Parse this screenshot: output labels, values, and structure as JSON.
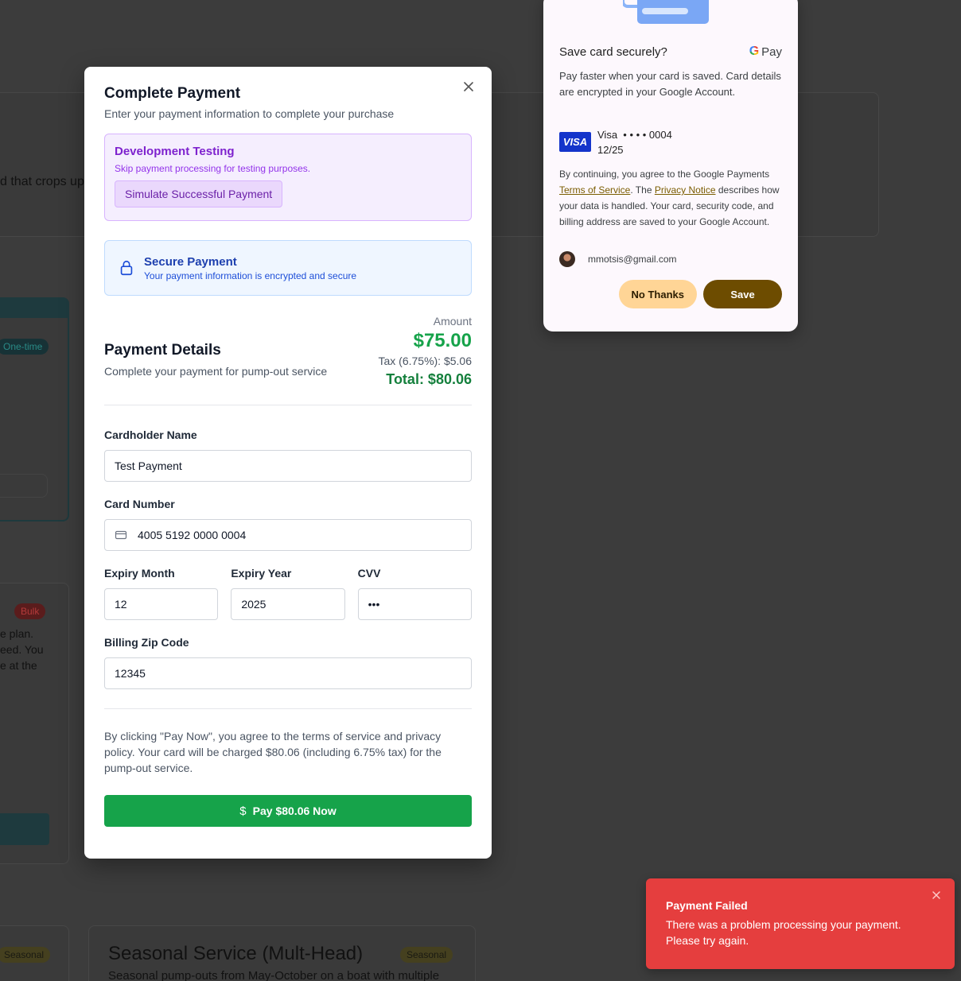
{
  "background": {
    "fragment_text_1": "d that crops up",
    "badge_onetime": "One-time",
    "badge_bulk": "Bulk",
    "fragment_lines": [
      "e plan.",
      "eed. You",
      "e at the"
    ],
    "badge_seasonal_left": "Seasonal",
    "seasonal_card_title": "Seasonal Service (Mult-Head)",
    "badge_seasonal_right": "Seasonal",
    "seasonal_card_desc": "Seasonal pump-outs from May-October on a boat with multiple"
  },
  "modal": {
    "title": "Complete Payment",
    "subtitle": "Enter your payment information to complete your purchase",
    "close_icon": "close-icon",
    "dev_testing": {
      "title": "Development Testing",
      "subtitle": "Skip payment processing for testing purposes.",
      "button_label": "Simulate Successful Payment"
    },
    "secure": {
      "icon": "lock-icon",
      "title": "Secure Payment",
      "subtitle": "Your payment information is encrypted and secure"
    },
    "details": {
      "title": "Payment Details",
      "subtitle": "Complete your payment for pump-out service",
      "amount_label": "Amount",
      "amount_value": "$75.00",
      "tax_line": "Tax (6.75%): $5.06",
      "total_line": "Total: $80.06"
    },
    "form": {
      "cardholder_label": "Cardholder Name",
      "cardholder_value": "Test Payment",
      "card_number_label": "Card Number",
      "card_number_value": "4005 5192 0000 0004",
      "expiry_month_label": "Expiry Month",
      "expiry_month_value": "12",
      "expiry_year_label": "Expiry Year",
      "expiry_year_value": "2025",
      "cvv_label": "CVV",
      "cvv_value": "•••",
      "zip_label": "Billing Zip Code",
      "zip_value": "12345"
    },
    "terms": "By clicking \"Pay Now\", you agree to the terms of service and privacy policy. Your card will be charged $80.06 (including 6.75% tax) for the pump-out service.",
    "pay_button": {
      "icon": "$",
      "label": "Pay $80.06 Now"
    }
  },
  "gpay": {
    "title": "Save card securely?",
    "logo_text": "Pay",
    "description": "Pay faster when your card is saved. Card details are encrypted in your Google Account.",
    "card_brand": "VISA",
    "card_line": "Visa  • • • • 0004",
    "card_expiry": "12/25",
    "legal_prefix": "By continuing, you agree to the Google Payments ",
    "legal_tos": "Terms of Service",
    "legal_mid": ". The ",
    "legal_privacy": "Privacy Notice",
    "legal_suffix": " describes how your data is handled. Your card, security code, and billing address are saved to your Google Account.",
    "email": "mmotsis@gmail.com",
    "no_thanks": "No Thanks",
    "save": "Save"
  },
  "toast": {
    "title": "Payment Failed",
    "message": "There was a problem processing your payment. Please try again."
  },
  "colors": {
    "overlay": "#3c3c3c",
    "pay_green": "#16a34a",
    "toast_red": "#e53e3e",
    "gpay_save": "#6d4c00",
    "gpay_nothanks": "#ffd596"
  }
}
